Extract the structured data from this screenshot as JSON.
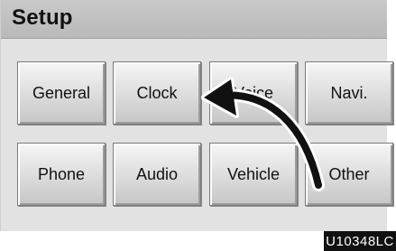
{
  "screen": {
    "title": "Setup",
    "buttons": [
      {
        "label": "General"
      },
      {
        "label": "Clock"
      },
      {
        "label": "Voice"
      },
      {
        "label": "Navi."
      },
      {
        "label": "Phone"
      },
      {
        "label": "Audio"
      },
      {
        "label": "Vehicle"
      },
      {
        "label": "Other"
      }
    ]
  },
  "figure_code": "U10348LC"
}
